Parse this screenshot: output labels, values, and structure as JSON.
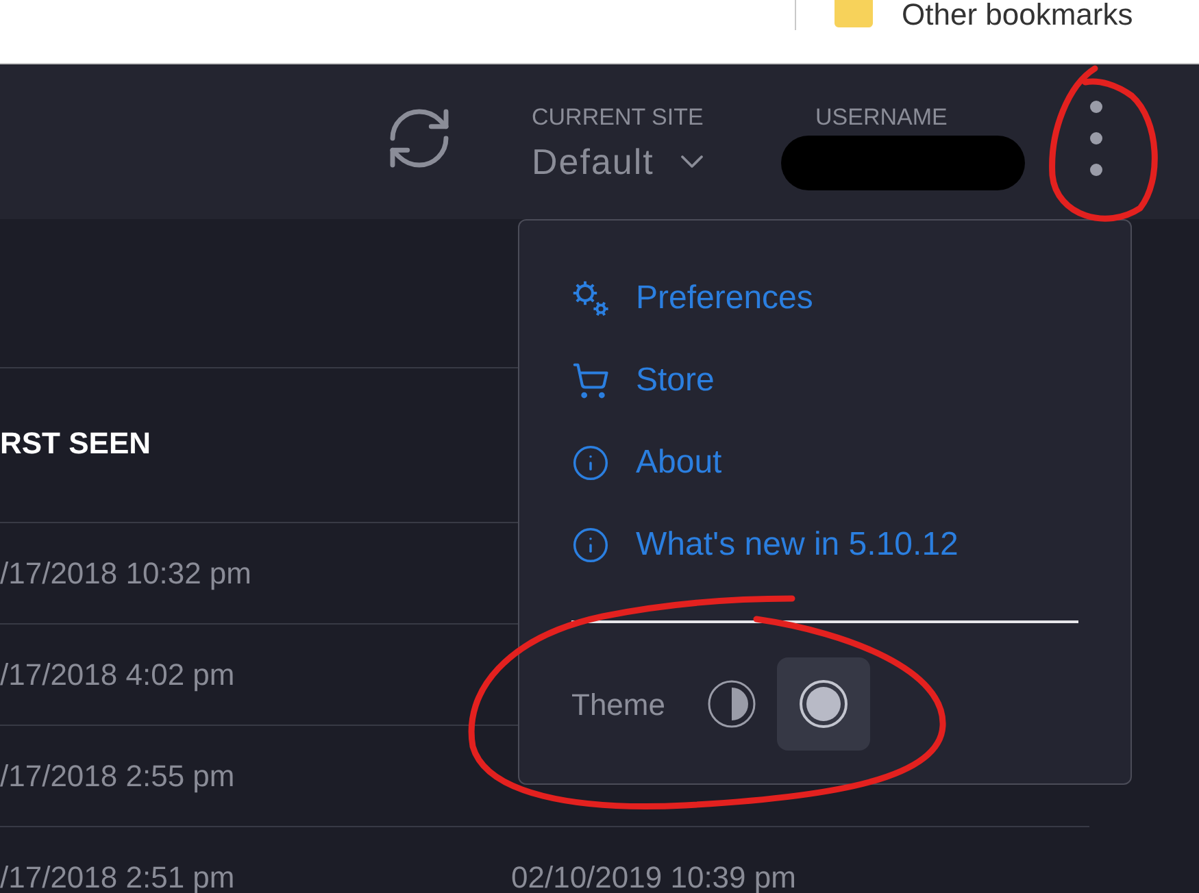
{
  "bookmarks_bar": {
    "items": [
      {
        "label": "Other bookmarks"
      }
    ]
  },
  "header": {
    "site": {
      "label": "CURRENT SITE",
      "value": "Default"
    },
    "user": {
      "label": "USERNAME",
      "redacted": true
    }
  },
  "table": {
    "columns": [
      {
        "label": "RST SEEN"
      }
    ],
    "rows": [
      {
        "cells": [
          "/17/2018 10:32 pm"
        ]
      },
      {
        "cells": [
          "/17/2018 4:02 pm"
        ]
      },
      {
        "cells": [
          "/17/2018 2:55 pm"
        ]
      },
      {
        "cells": [
          "/17/2018 2:51 pm",
          "02/10/2019 10:39 pm"
        ]
      }
    ]
  },
  "menu": {
    "items": [
      {
        "kind": "gears",
        "label": "Preferences"
      },
      {
        "kind": "cart",
        "label": "Store"
      },
      {
        "kind": "info",
        "label": "About"
      },
      {
        "kind": "info",
        "label": "What's new in 5.10.12"
      }
    ],
    "theme": {
      "label": "Theme",
      "options": [
        {
          "kind": "contrast",
          "selected": false
        },
        {
          "kind": "dark",
          "selected": true
        }
      ]
    }
  }
}
